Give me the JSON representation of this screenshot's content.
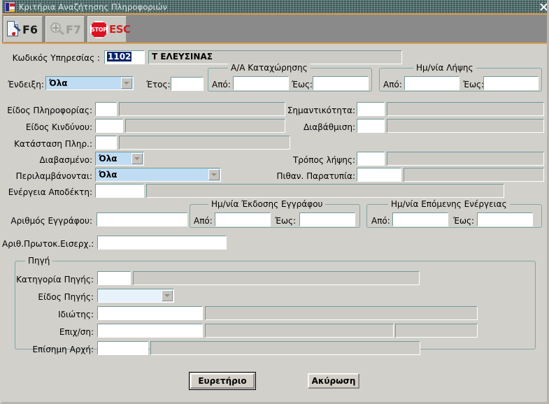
{
  "window": {
    "title": "Κριτήρια Αναζήτησης Πληροφοριών",
    "close_label": "×"
  },
  "toolbar": {
    "buttons": [
      {
        "key": "f6",
        "label": "F6",
        "icon": "page-pen-icon",
        "enabled": true
      },
      {
        "key": "f7",
        "label": "F7",
        "icon": "magnifier-plus-icon",
        "enabled": false
      },
      {
        "key": "esc",
        "label": "ESC",
        "icon": "stop-sign-icon",
        "enabled": true
      }
    ],
    "stop_text": "STOP"
  },
  "form": {
    "service_code": {
      "label": "Κωδικός Υπηρεσίας :",
      "value": "1102",
      "description": "Τ ΕΛΕΥΣΙΝΑΣ"
    },
    "indication": {
      "label": "Ένδειξη:",
      "value": "Όλα"
    },
    "year": {
      "label": "Έτος:",
      "value": ""
    },
    "registration_group": {
      "title": "Α/Α Καταχώρησης",
      "from_label": "Από:",
      "from_value": "",
      "to_label": "Έως:",
      "to_value": ""
    },
    "receipt_date_group": {
      "title": "Ημ/νία Λήψης",
      "from_label": "Από:",
      "from_value": "",
      "to_label": "Έως:",
      "to_value": ""
    },
    "info_type": {
      "label": "Είδος Πληροφορίας:",
      "code": "",
      "description": ""
    },
    "risk_type": {
      "label": "Είδος Κινδύνου:",
      "code": "",
      "description": ""
    },
    "info_status": {
      "label": "Κατάσταση Πληρ.:",
      "code": "",
      "description": ""
    },
    "importance": {
      "label": "Σημαντικότητα:",
      "code": "",
      "description": ""
    },
    "classification": {
      "label": "Διαβάθμιση:",
      "code": "",
      "description": ""
    },
    "read_state": {
      "label": "Διαβασμένο:",
      "value": "Όλα"
    },
    "included": {
      "label": "Περιλαμβάνονται:",
      "value": "Όλα"
    },
    "receipt_method": {
      "label": "Τρόπος λήψης:",
      "code": "",
      "description": ""
    },
    "possible_irregularity": {
      "label": "Πιθαν. Παρατυπία:",
      "code": "",
      "description": ""
    },
    "recipient_action": {
      "label": "Ενέργεια Αποδέκτη:",
      "code": "",
      "description": ""
    },
    "document_number": {
      "label": "Αριθμός Εγγράφου:",
      "value": ""
    },
    "incoming_protocol": {
      "label": "Αριθ.Πρωτοκ.Εισερχ.:",
      "value": ""
    },
    "issue_date_group": {
      "title": "Ημ/νία Έκδοσης Εγγράφου",
      "from_label": "Από:",
      "from_value": "",
      "to_label": "Έως:",
      "to_value": ""
    },
    "next_action_date_group": {
      "title": "Ημ/νία Επόμενης Ενέργειας",
      "from_label": "Από:",
      "from_value": "",
      "to_label": "Έως:",
      "to_value": ""
    },
    "source_group": {
      "title": "Πηγή",
      "category": {
        "label": "Κατηγορία Πηγής:",
        "code": "",
        "description": ""
      },
      "source_type": {
        "label": "Είδος Πηγής:",
        "value": ""
      },
      "individual": {
        "label": "Ιδιώτης:",
        "value": "",
        "description": ""
      },
      "business": {
        "label": "Επιχ/ση:",
        "value": "",
        "description": "",
        "extra": ""
      },
      "official_authority": {
        "label": "Επίσημη Αρχή:",
        "code": "",
        "description": ""
      }
    }
  },
  "actions": {
    "index_button": "Ευρετήριο",
    "cancel_button": "Ακύρωση"
  },
  "colors": {
    "titlebar": "#3d5b5b",
    "toolbar_accent": "#e09a3e",
    "panel": "#d2d0cb",
    "field_border": "#6f9a99",
    "combo_bg": "#bfdcf2",
    "selection": "#0a246a"
  }
}
